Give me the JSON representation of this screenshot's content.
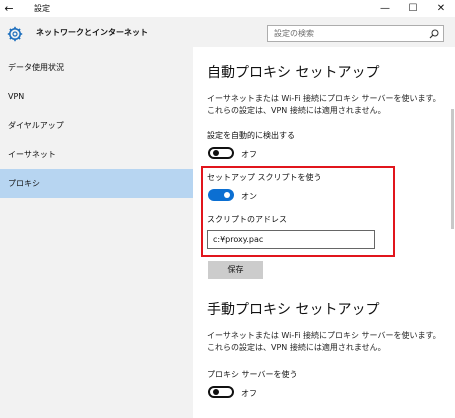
{
  "titlebar": {
    "title": "設定",
    "back_glyph": "←",
    "minimize_glyph": "—",
    "maximize_glyph": "☐",
    "close_glyph": "✕"
  },
  "sidebar": {
    "header": "ネットワークとインターネット",
    "items": [
      {
        "label": "データ使用状況"
      },
      {
        "label": "VPN"
      },
      {
        "label": "ダイヤルアップ"
      },
      {
        "label": "イーサネット"
      },
      {
        "label": "プロキシ"
      }
    ],
    "selected_index": 4
  },
  "search": {
    "placeholder": "設定の検索"
  },
  "auto_proxy": {
    "heading": "自動プロキシ セットアップ",
    "description": "イーサネットまたは Wi-Fi 接続にプロキシ サーバーを使います。これらの設定は、VPN 接続には適用されません。",
    "detect_label": "設定を自動的に検出する",
    "detect_state": "オフ",
    "script_label": "セットアップ スクリプトを使う",
    "script_state": "オン",
    "address_label": "スクリプトのアドレス",
    "address_value": "c:¥proxy.pac",
    "save_label": "保存"
  },
  "manual_proxy": {
    "heading": "手動プロキシ セットアップ",
    "description": "イーサネットまたは Wi-Fi 接続にプロキシ サーバーを使います。これらの設定は、VPN 接続には適用されません。",
    "use_label": "プロキシ サーバーを使う",
    "use_state": "オフ"
  },
  "colors": {
    "accent": "#0b6fd2",
    "highlight_box": "#e1151c",
    "selected_item": "#b7d5f1"
  }
}
